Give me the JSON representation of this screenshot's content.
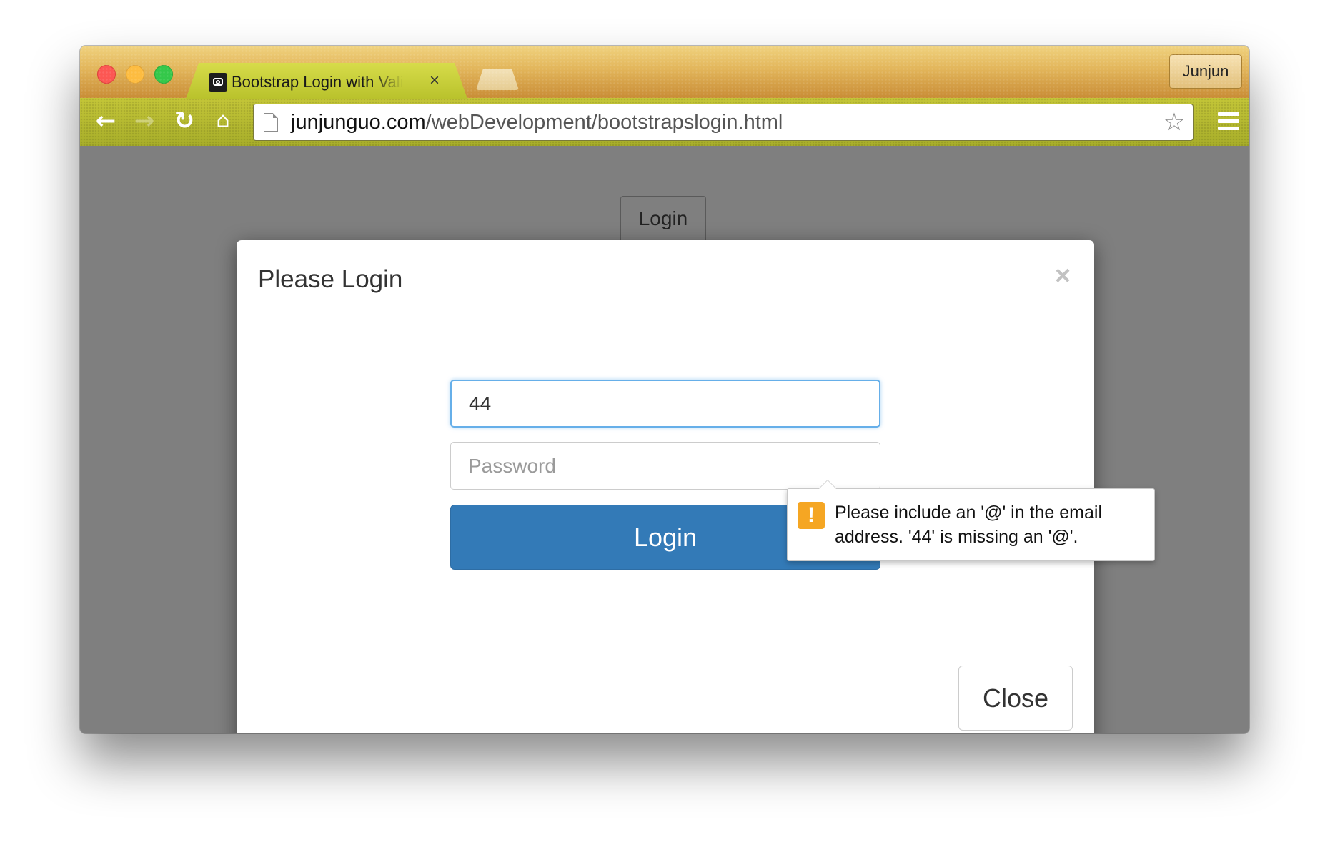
{
  "window": {
    "tab_title": "Bootstrap Login with Validation",
    "tab_close": "×",
    "profile_name": "Junjun"
  },
  "toolbar": {
    "url_host": "junjunguo.com",
    "url_path": "/webDevelopment/bootstrapslogin.html",
    "icons": [
      "back-arrow-icon",
      "forward-arrow-icon",
      "reload-icon",
      "home-icon",
      "page-icon",
      "star-icon",
      "menu-icon"
    ]
  },
  "page": {
    "background_login_label": "Login"
  },
  "modal": {
    "title": "Please Login",
    "close_x": "×",
    "email_value": "44",
    "password_placeholder": "Password",
    "login_label": "Login",
    "close_label": "Close"
  },
  "tooltip": {
    "icon_glyph": "!",
    "message_line1": "Please include an '@' in the email",
    "message_line2": "address. '44' is missing an '@'."
  },
  "colors": {
    "primary_button": "#337ab7",
    "input_focus_border": "#66afe9",
    "warning_icon": "#f5a623",
    "overlay": "#7f7f7f"
  }
}
